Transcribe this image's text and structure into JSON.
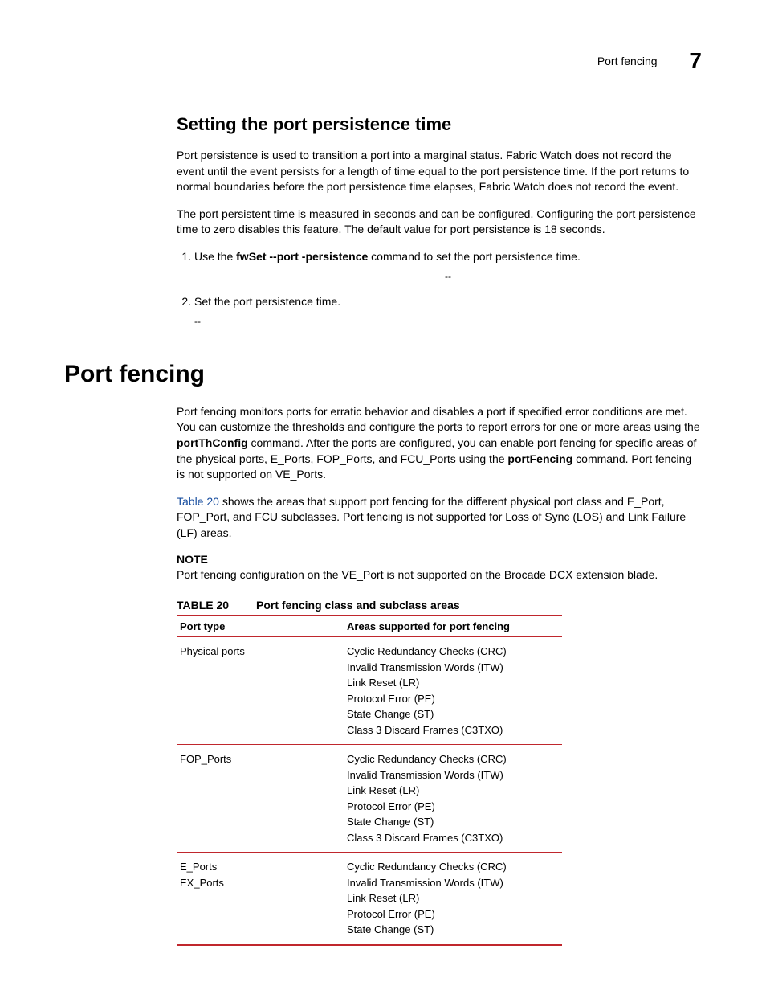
{
  "header": {
    "title": "Port fencing",
    "chapter_number": "7"
  },
  "section1": {
    "heading": "Setting the port persistence time",
    "p1": "Port persistence is used to transition a port into a marginal status. Fabric Watch does not record the event until the event persists for a length of time equal to the port persistence time. If the port returns to normal boundaries before the port persistence time elapses, Fabric Watch does not record the event.",
    "p2": "The port persistent time is measured in seconds and can be configured. Configuring the port persistence time to zero disables this feature. The default value for port persistence is 18 seconds.",
    "step1_pre": "Use the ",
    "step1_cmd": "fwSet --port -persistence",
    "step1_post": " command to set the port persistence time.",
    "dash": "--",
    "step2": "Set the port persistence time."
  },
  "section2": {
    "heading": "Port fencing",
    "p1_a": "Port fencing monitors ports for erratic behavior and disables a port if specified error conditions are met. You can customize the thresholds and configure the ports to report errors for one or more areas using the ",
    "p1_cmd1": "portThConfig",
    "p1_b": " command. After the ports are configured, you can enable port fencing for specific areas of the physical ports, E_Ports, FOP_Ports, and FCU_Ports using the ",
    "p1_cmd2": "portFencing",
    "p1_c": " command. Port fencing is not supported on VE_Ports.",
    "p2_link": "Table 20",
    "p2_rest": " shows the areas that support port fencing for the different physical port class and E_Port, FOP_Port, and FCU subclasses. Port fencing is not supported for Loss of Sync (LOS) and Link Failure (LF) areas.",
    "note_label": "NOTE",
    "note_text": "Port fencing configuration on the VE_Port is not supported on the Brocade DCX extension blade."
  },
  "table": {
    "label": "TABLE 20",
    "title": "Port fencing class and subclass areas",
    "col1": "Port type",
    "col2": "Areas supported for port fencing",
    "rows": [
      {
        "port_type": "Physical ports",
        "areas": "Cyclic Redundancy Checks (CRC)\nInvalid Transmission Words (ITW)\nLink Reset (LR)\nProtocol Error (PE)\nState Change (ST)\nClass 3 Discard Frames (C3TXO)"
      },
      {
        "port_type": "FOP_Ports",
        "areas": "Cyclic Redundancy Checks (CRC)\nInvalid Transmission Words (ITW)\nLink Reset (LR)\nProtocol Error (PE)\nState Change (ST)\nClass 3 Discard Frames (C3TXO)"
      },
      {
        "port_type": "E_Ports\nEX_Ports",
        "areas": "Cyclic Redundancy Checks (CRC)\nInvalid Transmission Words (ITW)\nLink Reset (LR)\nProtocol Error (PE)\nState Change (ST)"
      }
    ]
  }
}
